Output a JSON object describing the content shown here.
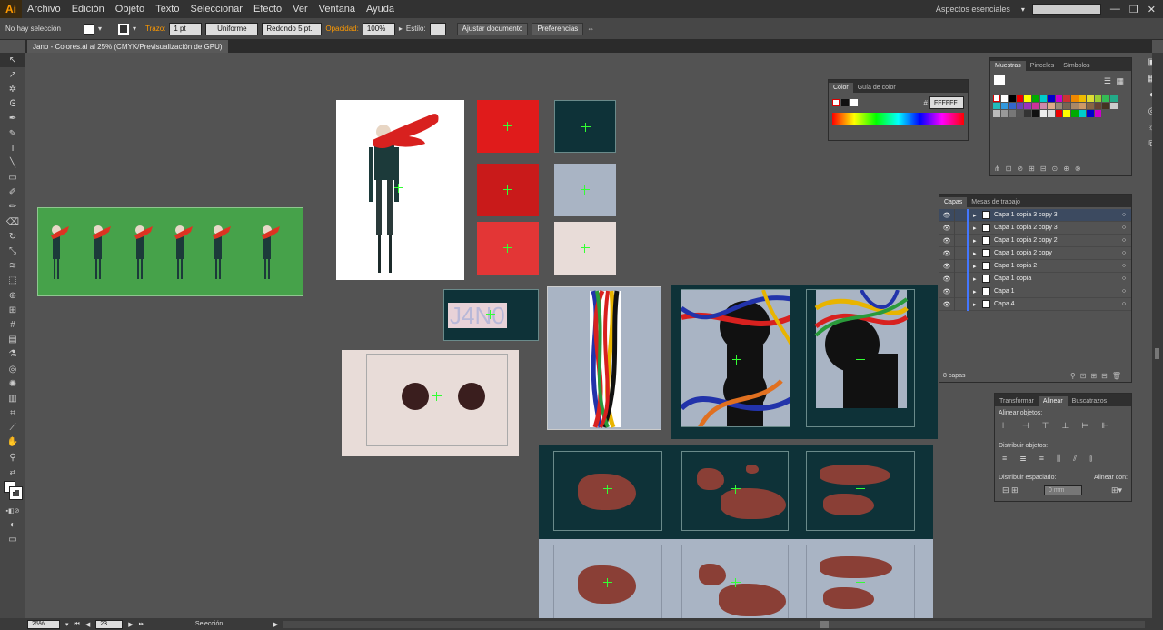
{
  "app": {
    "logo": "Ai",
    "workspace": "Aspectos esenciales"
  },
  "menu": [
    "Archivo",
    "Edición",
    "Objeto",
    "Texto",
    "Seleccionar",
    "Efecto",
    "Ver",
    "Ventana",
    "Ayuda"
  ],
  "control": {
    "selection": "No hay selección",
    "stroke_label": "Trazo:",
    "stroke_value": "1 pt",
    "stroke_type": "Uniforme",
    "brush": "Redondo 5 pt.",
    "opacity_label": "Opacidad:",
    "opacity_value": "100%",
    "style_label": "Estilo:",
    "doc_setup": "Ajustar documento",
    "prefs": "Preferencias"
  },
  "doc_tab": "Jano - Colores.ai al 25% (CMYK/Previsualización de GPU)",
  "canvas_text": "J4N0",
  "color_panel": {
    "tabs": [
      "Color",
      "Guía de color"
    ],
    "hex": "FFFFFF"
  },
  "swatches_panel": {
    "tabs": [
      "Muestras",
      "Pinceles",
      "Símbolos"
    ]
  },
  "layers_panel": {
    "tabs": [
      "Capas",
      "Mesas de trabajo"
    ],
    "layers": [
      "Capa 1 copia 3 copy 3",
      "Capa 1 copia 2 copy 3",
      "Capa 1 copia 2 copy 2",
      "Capa 1 copia 2 copy",
      "Capa 1 copia 2",
      "Capa 1 copia",
      "Capa 1",
      "Capa 4"
    ],
    "count": "8 capas"
  },
  "align_panel": {
    "tabs": [
      "Transformar",
      "Alinear",
      "Buscatrazos"
    ],
    "align_objects": "Alinear objetos:",
    "distribute_objects": "Distribuir objetos:",
    "distribute_spacing": "Distribuir espaciado:",
    "align_to": "Alinear con:",
    "spacing_value": "0 mm"
  },
  "status": {
    "zoom": "25%",
    "page": "23",
    "tool": "Selección"
  },
  "colors": {
    "accent": "#ff9a00",
    "teal": "#0e3238",
    "red": "#e01b1b",
    "canvas": "#535353"
  }
}
